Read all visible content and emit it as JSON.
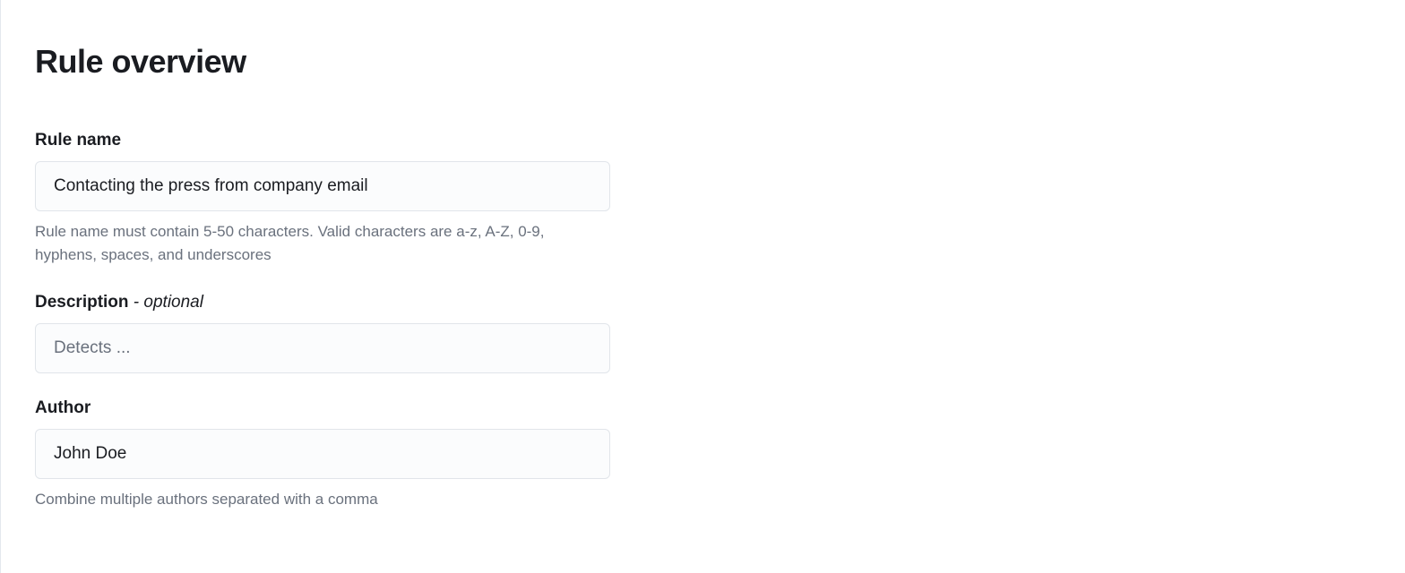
{
  "page": {
    "title": "Rule overview"
  },
  "fields": {
    "rule_name": {
      "label": "Rule name",
      "value": "Contacting the press from company email",
      "help": "Rule name must contain 5-50 characters. Valid characters are a-z, A-Z, 0-9, hyphens, spaces, and underscores"
    },
    "description": {
      "label": "Description",
      "suffix": " - optional",
      "placeholder": "Detects ...",
      "value": ""
    },
    "author": {
      "label": "Author",
      "value": "John Doe",
      "help": "Combine multiple authors separated with a comma"
    }
  }
}
